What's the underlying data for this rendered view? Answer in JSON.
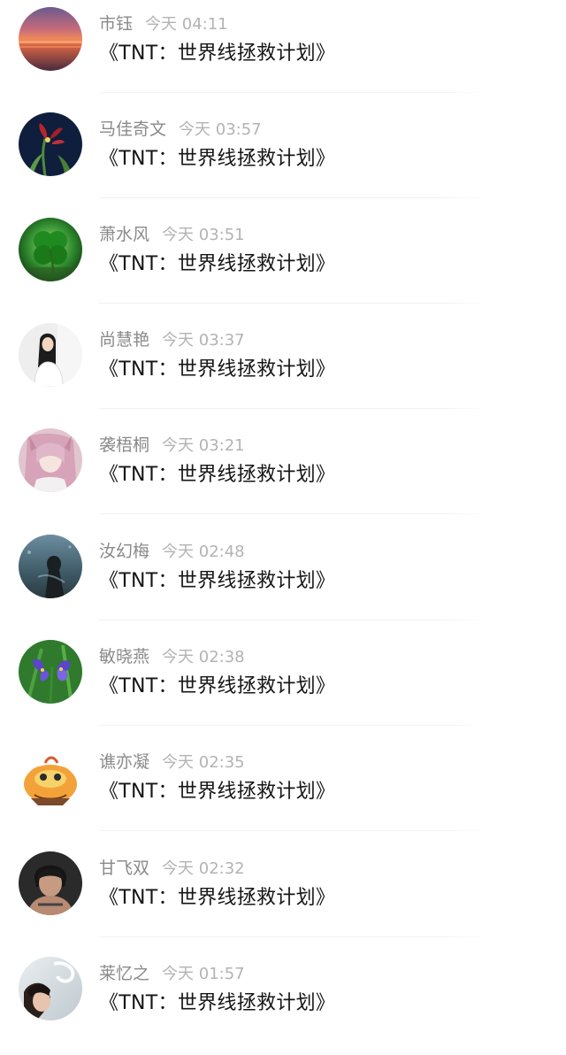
{
  "comments": [
    {
      "name": "市钰",
      "time": "今天 04:11",
      "content": "《TNT：世界线拯救计划》",
      "avatar": "sunset-avatar"
    },
    {
      "name": "马佳奇文",
      "time": "今天 03:57",
      "content": "《TNT：世界线拯救计划》",
      "avatar": "red-flower-avatar"
    },
    {
      "name": "萧水风",
      "time": "今天 03:51",
      "content": "《TNT：世界线拯救计划》",
      "avatar": "clover-avatar"
    },
    {
      "name": "尚慧艳",
      "time": "今天 03:37",
      "content": "《TNT：世界线拯救计划》",
      "avatar": "girl-portrait-avatar"
    },
    {
      "name": "袭梧桐",
      "time": "今天 03:21",
      "content": "《TNT：世界线拯救计划》",
      "avatar": "anime-girl-avatar"
    },
    {
      "name": "汝幻梅",
      "time": "今天 02:48",
      "content": "《TNT：世界线拯救计划》",
      "avatar": "dark-figure-avatar"
    },
    {
      "name": "敏晓燕",
      "time": "今天 02:38",
      "content": "《TNT：世界线拯救计划》",
      "avatar": "iris-flower-avatar"
    },
    {
      "name": "谯亦凝",
      "time": "今天 02:35",
      "content": "《TNT：世界线拯救计划》",
      "avatar": "cartoon-cat-avatar"
    },
    {
      "name": "甘飞双",
      "time": "今天 02:32",
      "content": "《TNT：世界线拯救计划》",
      "avatar": "boy-portrait-avatar"
    },
    {
      "name": "莱忆之",
      "time": "今天 01:57",
      "content": "《TNT：世界线拯救计划》",
      "avatar": "smoke-boy-avatar"
    }
  ]
}
